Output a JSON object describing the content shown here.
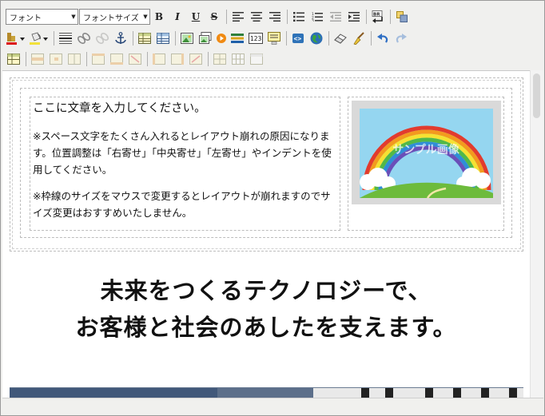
{
  "toolbar1": {
    "font_select": "フォント",
    "font_size_select": "フォントサイズ",
    "bold": "B",
    "italic": "I",
    "underline": "U",
    "strike": "S"
  },
  "content": {
    "para1": "ここに文章を入力してください。",
    "para2": "※スペース文字をたくさん入れるとレイアウト崩れの原因になります。位置調整は「右寄せ」「中央寄せ」「左寄せ」やインデントを使用してください。",
    "para3": "※枠線のサイズをマウスで変更するとレイアウトが崩れますのでサイズ変更はおすすめいたしません。",
    "sample_image_text": "サンプル画像",
    "headline_line1": "未来をつくるテクノロジーで、",
    "headline_line2": "お客様と社会のあしたを支えます。"
  },
  "colors": {
    "toolbar_bg": "#f0f0ee",
    "border": "#9a9a9a",
    "sky": "#8fd3ef",
    "grass": "#6dbb3c"
  }
}
